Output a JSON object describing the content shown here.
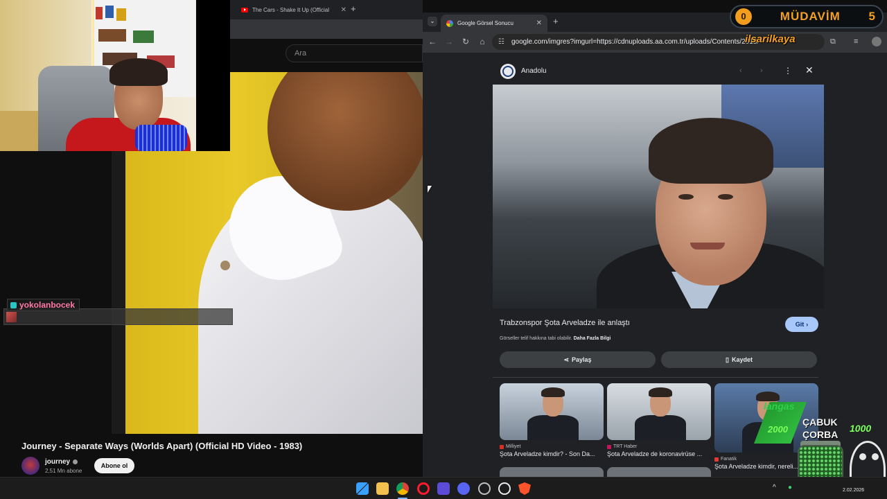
{
  "youtube": {
    "tab_title": "The Cars - Shake It Up (Official",
    "search_placeholder": "Ara",
    "video_title": "Journey - Separate Ways (Worlds Apart) (Official HD Video - 1983)",
    "channel_name": "journey",
    "subscriber_count": "2,51 Mn abone",
    "subscribe_label": "Abone ol"
  },
  "chat": {
    "username": "yokolanbocek"
  },
  "chrome": {
    "tab_title": "Google Görsel Sonucu",
    "url": "google.com/imgres?imgurl=https://cdnuploads.aa.com.tr/uploads/Contents/2015/"
  },
  "image_panel": {
    "source_name": "Anadolu",
    "title": "Trabzonspor Şota Arveladze ile anlaştı",
    "visit_label": "Git",
    "copyright_text": "Görseller telif hakkına tabi olabilir.",
    "more_info_label": "Daha Fazla Bilgi",
    "share_label": "Paylaş",
    "save_label": "Kaydet",
    "related": [
      {
        "source": "Milliyet",
        "caption": "Şota Arveladze kimdir? - Son Da...",
        "source_color": "#d93025"
      },
      {
        "source": "TRT Haber",
        "caption": "Şota Arveladze de koronavirüse ...",
        "source_color": "#c2185b"
      },
      {
        "source": "Fanatik",
        "caption": "Şota Arveladze kimdir, nereli...",
        "source_color": "#e53935"
      }
    ]
  },
  "overlay": {
    "badge_left_count": "0",
    "badge_label": "MÜDAVİM",
    "badge_right_count": "5",
    "streamer_name": "ilsarilkaya",
    "goal_small_label": "langas",
    "goal_current": "2000",
    "goal_title_line1": "ÇABUK",
    "goal_title_line2": "ÇORBA",
    "goal_target": "1000"
  },
  "taskbar": {
    "date": "2.02.2026"
  },
  "colors": {
    "youtube_red": "#ff0000",
    "chrome_dark": "#202124",
    "accent_orange": "#f2a024",
    "google_button_blue": "#a8c7fa",
    "chat_name_pink": "#ff7aa8"
  }
}
